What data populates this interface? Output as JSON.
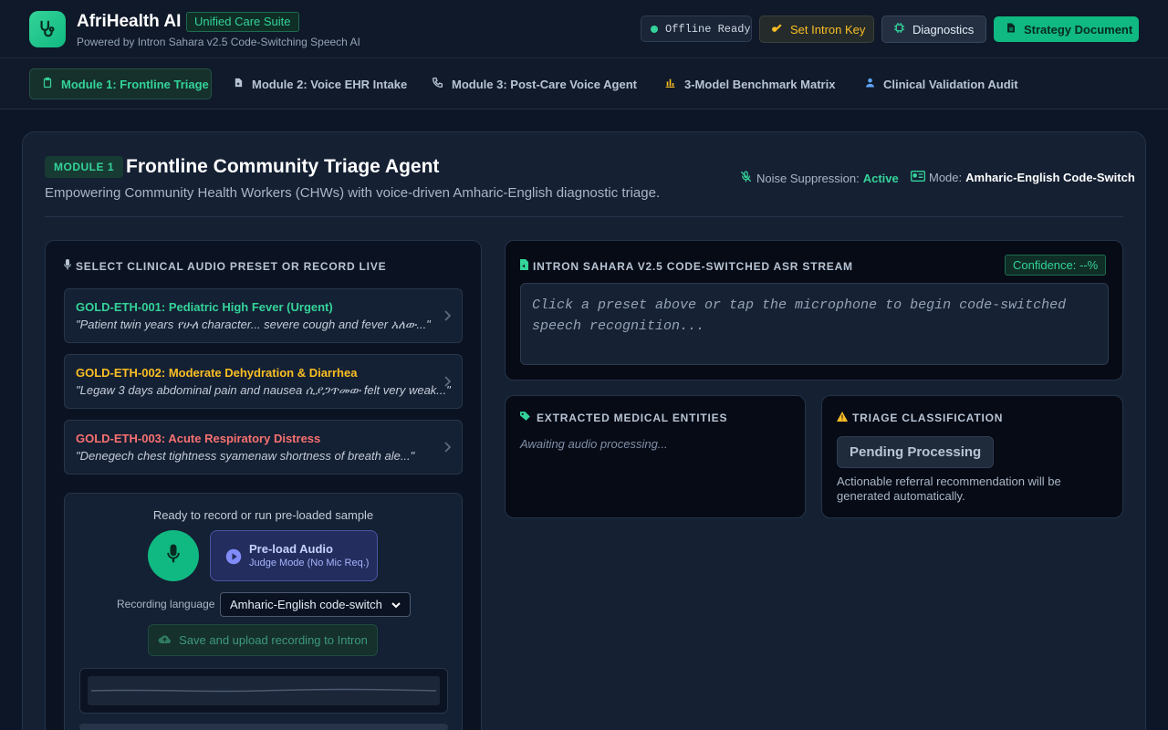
{
  "app": {
    "title": "AfriHealth AI",
    "suite_badge": "Unified Care Suite",
    "powered_by": "Powered by Intron Sahara v2.5 Code-Switching Speech AI"
  },
  "header_actions": {
    "offline": "Offline Ready",
    "intron_key": "Set Intron Key",
    "diagnostics": "Diagnostics",
    "strategy": "Strategy Document"
  },
  "tabs": [
    {
      "label": "Module 1: Frontline Triage",
      "icon": "clipboard-icon"
    },
    {
      "label": "Module 2: Voice EHR Intake",
      "icon": "file-medical-icon"
    },
    {
      "label": "Module 3: Post-Care Voice Agent",
      "icon": "phone-icon"
    },
    {
      "label": "3-Model Benchmark Matrix",
      "icon": "bar-chart-icon"
    },
    {
      "label": "Clinical Validation Audit",
      "icon": "user-md-icon"
    }
  ],
  "module": {
    "badge": "MODULE 1",
    "title": "Frontline Community Triage Agent",
    "subtitle": "Empowering Community Health Workers (CHWs) with voice-driven Amharic-English diagnostic triage.",
    "noise_label": "Noise Suppression:",
    "noise_value": "Active",
    "mode_label": "Mode:",
    "mode_value": "Amharic-English Code-Switch"
  },
  "presets_panel": {
    "heading": "Select Clinical Audio Preset or Record Live",
    "items": [
      {
        "title": "GOLD-ETH-001: Pediatric High Fever (Urgent)",
        "quote": "\"Patient twin years የሁለ character... severe cough and fever አለው...\"",
        "color": "#34d399"
      },
      {
        "title": "GOLD-ETH-002: Moderate Dehydration & Diarrhea",
        "quote": "\"Legaw 3 days abdominal pain and nausea ሲያጋጥመው felt very weak...\"",
        "color": "#fbbf24"
      },
      {
        "title": "GOLD-ETH-003: Acute Respiratory Distress",
        "quote": "\"Denegech chest tightness syamenaw shortness of breath ale...\"",
        "color": "#f87171"
      }
    ]
  },
  "recorder": {
    "status": "Ready to record or run pre-loaded sample",
    "preload_main": "Pre-load Audio",
    "preload_sub": "Judge Mode (No Mic Req.)",
    "language_label": "Recording language",
    "language_value": "Amharic-English code-switch",
    "upload": "Save and upload recording to Intron"
  },
  "asr": {
    "heading": "Intron Sahara v2.5 Code-Switched ASR Stream",
    "confidence": "Confidence: --%",
    "placeholder": "Click a preset above or tap the microphone to begin code-switched speech recognition..."
  },
  "entities": {
    "heading": "Extracted Medical Entities",
    "awaiting": "Awaiting audio processing..."
  },
  "triage": {
    "heading": "Triage Classification",
    "status": "Pending Processing",
    "note": "Actionable referral recommendation will be generated automatically."
  },
  "colors": {
    "accent": "#10b981",
    "accent_text": "#34d399",
    "warning": "#fbbf24",
    "danger": "#f87171",
    "background": "#0d1626"
  }
}
